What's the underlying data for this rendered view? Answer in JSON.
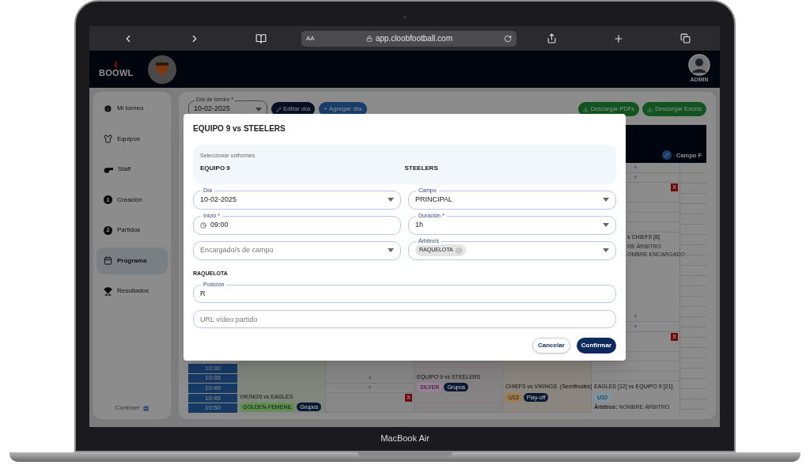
{
  "device_label": "MacBook Air",
  "browser": {
    "text_size": "AA",
    "url": "app.cloobfootball.com"
  },
  "app_header": {
    "logo": "BOOWL",
    "user_label": "ADMIN"
  },
  "sidebar": {
    "items": [
      {
        "label": "Mi torneo",
        "selected": false
      },
      {
        "label": "Equipos",
        "selected": false
      },
      {
        "label": "Staff",
        "selected": false
      },
      {
        "label": "Creación",
        "number": "1",
        "selected": false
      },
      {
        "label": "Partidos",
        "number": "2",
        "selected": false
      },
      {
        "label": "Programa",
        "selected": true
      },
      {
        "label": "Resultados",
        "selected": false
      }
    ],
    "collapse": "Contraer"
  },
  "toolbar": {
    "day_field": {
      "label": "Día de torneo *",
      "value": "10-02-2025"
    },
    "buttons": [
      {
        "label": "Editar día",
        "kind": "edit"
      },
      {
        "label": "+ Agregar día",
        "kind": "add"
      }
    ],
    "downloads": [
      {
        "label": "Descargar PDFs"
      },
      {
        "label": "Descargar Excels"
      }
    ]
  },
  "schedule": {
    "last_header": "Campo F",
    "times": [
      "10:30",
      "10:35",
      "10:40",
      "10:45",
      "10:50"
    ],
    "columns": [
      {
        "bottom": [
          {
            "kind": "match",
            "title": "VIKINGS vs EAGLES",
            "tags": [
              {
                "label": "GOLDEN-FEMENIL",
                "color": "#5f8f4f"
              },
              {
                "label": "Grupos",
                "color": "#0a1a35"
              }
            ]
          }
        ]
      },
      {
        "bottom": [
          {
            "kind": "add",
            "label": "+"
          },
          {
            "kind": "add",
            "label": "+"
          },
          {
            "kind": "delete",
            "label": "X"
          },
          {
            "kind": "spacer"
          }
        ]
      },
      {
        "bottom": [
          {
            "kind": "match",
            "title": "EQUIPO 9 vs STEELERS",
            "tags": [
              {
                "label": "SILVER",
                "color": "#9c7f99"
              },
              {
                "label": "Grupos",
                "color": "#0a1a35"
              }
            ]
          },
          {
            "kind": "spacer"
          },
          {
            "kind": "spacer"
          }
        ]
      },
      {
        "bottom": [
          {
            "kind": "match",
            "title": "CHIEFS vs VIKINGS  (Semifinales)",
            "tags": [
              {
                "label": "U12",
                "color": "#9d7a4a"
              },
              {
                "label": "Play-off",
                "color": "#0a1a35"
              }
            ]
          },
          {
            "kind": "spacer"
          }
        ]
      },
      {
        "top": [
          {
            "kind": "add",
            "label": "+"
          },
          {
            "kind": "add",
            "label": "+"
          },
          {
            "kind": "delete",
            "label": "X"
          },
          {
            "kind": "spacer"
          },
          {
            "kind": "spacer"
          },
          {
            "kind": "spacer"
          },
          {
            "kind": "spacer"
          },
          {
            "kind": "text",
            "label": "s CHIEFS [8]"
          },
          {
            "kind": "note",
            "label": "RE ÁRBITRO"
          },
          {
            "kind": "note",
            "label": "OMBRE ENCARGADO"
          }
        ],
        "bottom": [
          {
            "kind": "add",
            "label": "+"
          },
          {
            "kind": "add",
            "label": "+"
          },
          {
            "kind": "delete",
            "label": "X"
          },
          {
            "kind": "spacer"
          },
          {
            "kind": "spacer"
          },
          {
            "kind": "spacer"
          },
          {
            "kind": "spacer"
          },
          {
            "kind": "match",
            "title": "EAGLES [12] vs EQUIPO 9 [21]",
            "tags": [
              {
                "label": "U10",
                "color": "#7895a8"
              }
            ],
            "referees_label": "Árbitros:",
            "referees": "NOMBRE ÁRBITRO"
          }
        ]
      }
    ]
  },
  "modal": {
    "title": "EQUIPO 9 vs STEELERS",
    "uniforms": {
      "label": "Seleccionar uniformes",
      "teams": [
        "EQUIPO 9",
        "STEELERS"
      ]
    },
    "fields": [
      {
        "kind": "select",
        "label": "Día",
        "value": "10-02-2025"
      },
      {
        "kind": "time",
        "label": "Inicio *",
        "value": "09:00"
      },
      {
        "kind": "select",
        "placeholder": "Encargado/s de campo"
      },
      {
        "kind": "select",
        "label": "Campo",
        "value": "PRINCIPAL"
      },
      {
        "kind": "select",
        "label": "Duración *",
        "value": "1h"
      },
      {
        "kind": "chips",
        "label": "Árbitro/s",
        "chips": [
          "RAQUELOTA"
        ]
      }
    ],
    "referee": {
      "name": "RAQUELOTA",
      "position_label": "Posición",
      "position_value": "R"
    },
    "video_url": {
      "placeholder": "URL vídeo partido"
    },
    "buttons": [
      {
        "label": "Cancelar",
        "kind": "secondary"
      },
      {
        "label": "Confirmar",
        "kind": "primary"
      }
    ]
  }
}
